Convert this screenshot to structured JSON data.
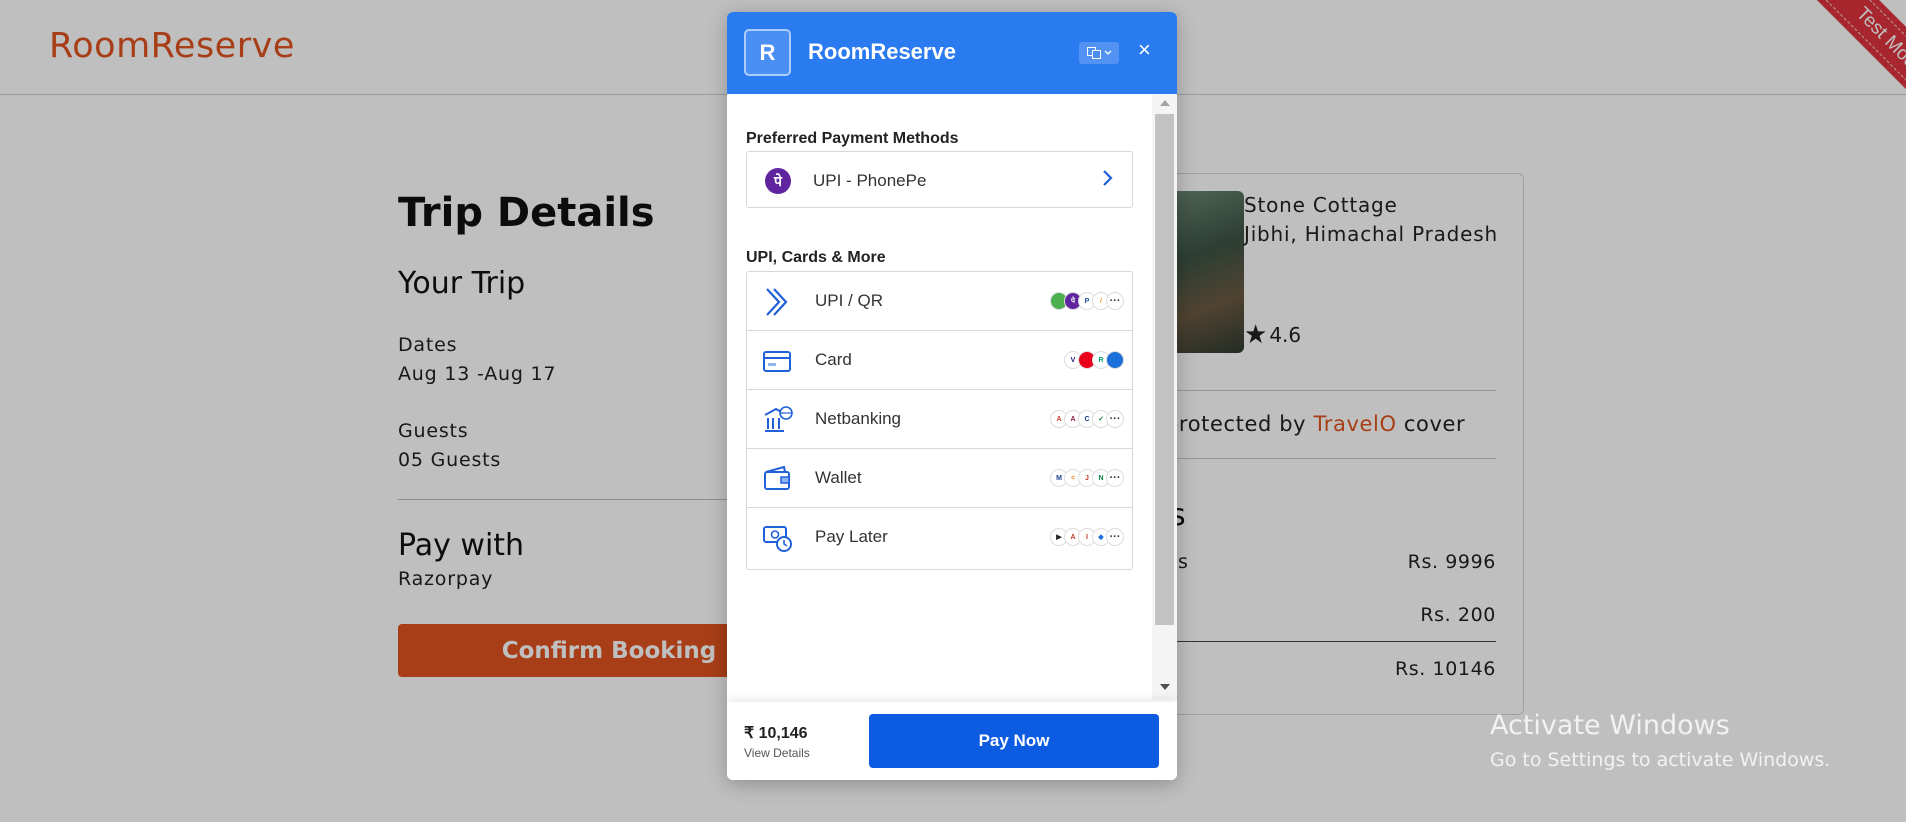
{
  "site": {
    "logo": "RoomReserve"
  },
  "trip": {
    "title": "Trip Details",
    "your_trip": "Your Trip",
    "dates_label": "Dates",
    "dates_value": "Aug 13 -Aug 17",
    "guests_label": "Guests",
    "guests_value": "05 Guests",
    "pay_with_label": "Pay with",
    "pay_with_value": "Razorpay",
    "confirm_button": "Confirm Booking"
  },
  "summary": {
    "property_name": "Stone Cottage",
    "location": "Jibhi, Himachal Pradesh",
    "rating": "4.6",
    "protected_prefix": "protected by ",
    "protected_brand": "TravelO",
    "protected_suffix": " cover",
    "price_heading_fragment": "s",
    "rows": [
      {
        "label": "ts",
        "value": "Rs. 9996"
      },
      {
        "label": "",
        "value": "Rs. 200"
      },
      {
        "label": "",
        "value": "Rs. 10146"
      }
    ]
  },
  "ribbon": {
    "label": "Test Mode"
  },
  "watermark": {
    "line1": "Activate Windows",
    "line2": "Go to Settings to activate Windows."
  },
  "modal": {
    "logo_letter": "R",
    "merchant_name": "RoomReserve",
    "close_symbol": "×",
    "preferred_title": "Preferred Payment Methods",
    "preferred_item": "UPI - PhonePe",
    "more_title": "UPI, Cards & More",
    "methods": [
      {
        "label": "UPI / QR",
        "icon": "upi-qr-icon"
      },
      {
        "label": "Card",
        "icon": "card-icon"
      },
      {
        "label": "Netbanking",
        "icon": "bank-icon"
      },
      {
        "label": "Wallet",
        "icon": "wallet-icon"
      },
      {
        "label": "Pay Later",
        "icon": "pay-later-icon"
      }
    ],
    "more_symbol": "···",
    "amount": "₹ 10,146",
    "view_details": "View Details",
    "pay_button": "Pay Now"
  },
  "colors": {
    "brand_orange": "#e0531f",
    "razorpay_blue": "#2b7bf0",
    "pay_button": "#0d5be0",
    "ribbon_red": "#e1343f"
  }
}
